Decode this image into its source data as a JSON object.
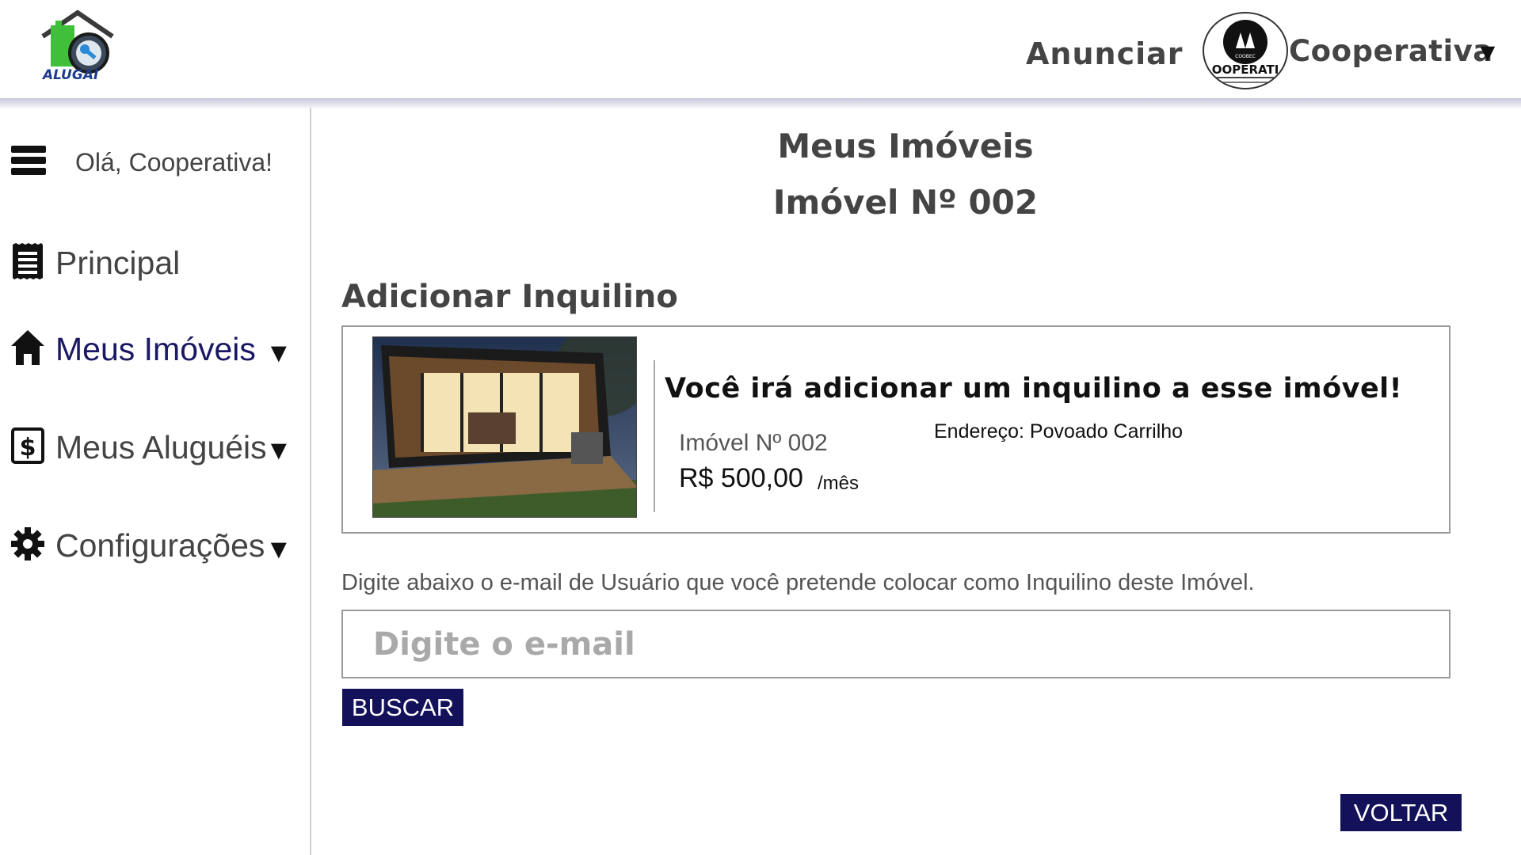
{
  "header": {
    "logo_text": "ALUGAÍ",
    "nav_anunciar": "Anunciar",
    "avatar_text": "OOPERATI",
    "avatar_small_text": "COOBEC",
    "user_menu_label": "Cooperativa",
    "user_menu_caret": "▼"
  },
  "sidebar": {
    "greeting": "Olá, Cooperativa!",
    "items": [
      {
        "label": "Principal",
        "caret": ""
      },
      {
        "label": "Meus Imóveis",
        "caret": "▼"
      },
      {
        "label": "Meus Aluguéis",
        "caret": "▼"
      },
      {
        "label": "Configurações",
        "caret": "▼"
      }
    ]
  },
  "main": {
    "title": "Meus Imóveis",
    "subtitle": "Imóvel Nº 002",
    "section_title": "Adicionar Inquilino",
    "card": {
      "headline": "Você irá adicionar um inquilino a esse imóvel!",
      "imovel": "Imóvel Nº 002",
      "price": "R$ 500,00",
      "unit": "/mês",
      "address": "Endereço: Povoado Carrilho"
    },
    "instructions": "Digite abaixo o e-mail de Usuário que você pretende colocar como Inquilino deste Imóvel.",
    "email_placeholder": "Digite o e-mail",
    "buscar_label": "BUSCAR",
    "voltar_label": "VOLTAR"
  },
  "colors": {
    "accent_navy": "#12115a",
    "active_nav": "#1a1863",
    "logo_green": "#3fbf3a"
  }
}
